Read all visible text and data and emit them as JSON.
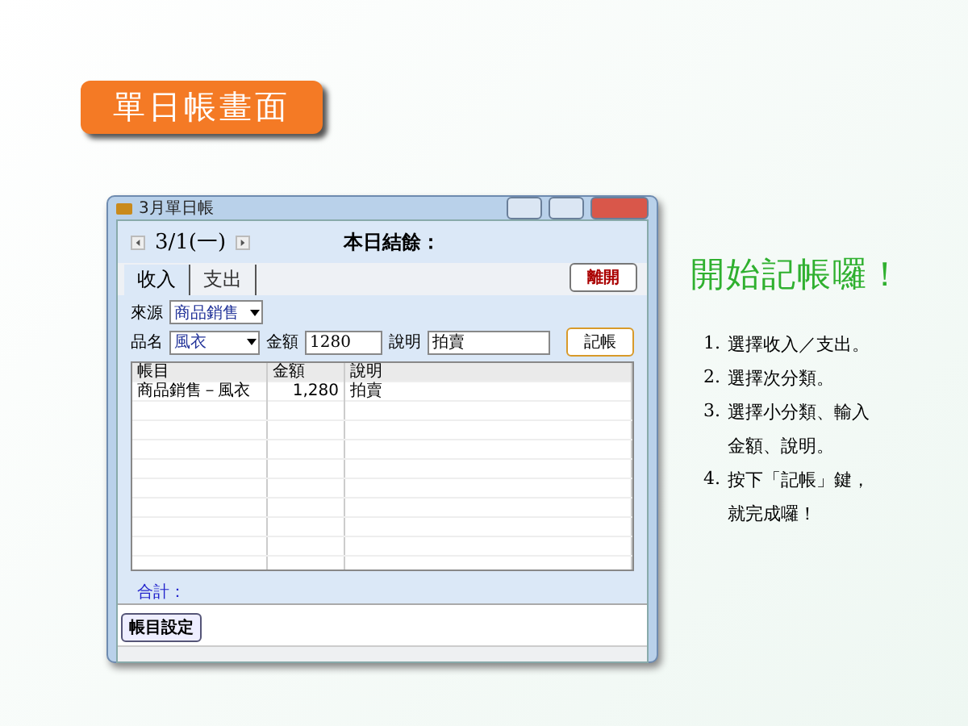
{
  "banner": "單日帳畫面",
  "window": {
    "title": "3月單日帳",
    "date": "3/1(一)",
    "balance_label": "本日結餘：",
    "tabs": [
      {
        "label": "收入",
        "selected": true
      },
      {
        "label": "支出",
        "selected": false
      }
    ],
    "exit_button": "離開",
    "form": {
      "source_label": "來源",
      "source_value": "商品銷售",
      "item_label": "品名",
      "item_value": "風衣",
      "amount_label": "金額",
      "amount_value": "1280",
      "note_label": "說明",
      "note_value": "拍賣",
      "submit": "記帳"
    },
    "table": {
      "columns": [
        "帳目",
        "金額",
        "說明"
      ],
      "rows": [
        [
          "商品銷售－風衣",
          "1,280",
          "拍賣"
        ]
      ]
    },
    "total_label": "合計：",
    "settings_button": "帳目設定"
  },
  "steps": {
    "title": "開始記帳囉！",
    "items": [
      {
        "number": "1.",
        "lines": [
          "選擇收入／支出。"
        ]
      },
      {
        "number": "2.",
        "lines": [
          "選擇次分類。"
        ]
      },
      {
        "number": "3.",
        "lines": [
          "選擇小分類、輸入",
          "金額、說明。"
        ]
      },
      {
        "number": "4.",
        "lines": [
          "按下「記帳」鍵，",
          "就完成囉！"
        ]
      }
    ]
  }
}
